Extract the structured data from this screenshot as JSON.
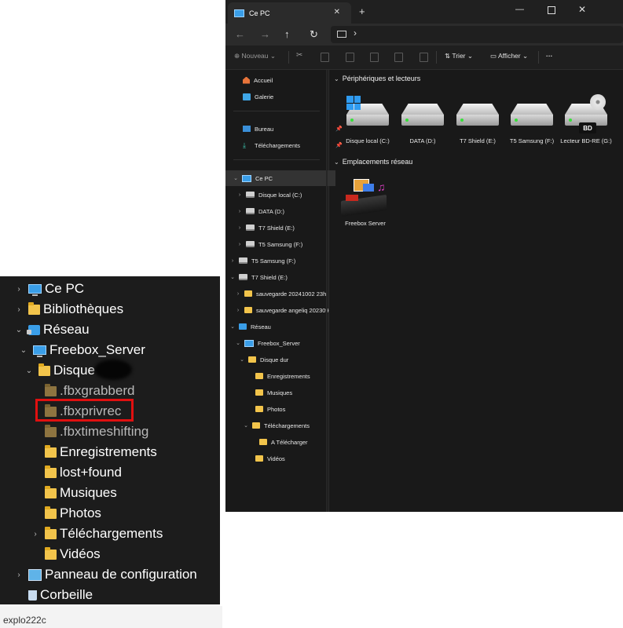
{
  "left_tree": {
    "items": [
      {
        "label": "Ce PC",
        "chev": "›",
        "icon": "pc-icon"
      },
      {
        "label": "Bibliothèques",
        "chev": "›",
        "icon": "folder-icon"
      },
      {
        "label": "Réseau",
        "chev": "⌄",
        "icon": "network-icon"
      },
      {
        "label": "Freebox_Server",
        "chev": "⌄",
        "icon": "pc-icon"
      },
      {
        "label": "Disque",
        "chev": "⌄",
        "icon": "folder-icon"
      },
      {
        "label": ".fbxgrabberd",
        "chev": "",
        "icon": "folder-icon"
      },
      {
        "label": ".fbxprivrec",
        "chev": "",
        "icon": "folder-icon"
      },
      {
        "label": ".fbxtimeshifting",
        "chev": "",
        "icon": "folder-icon"
      },
      {
        "label": "Enregistrements",
        "chev": "",
        "icon": "folder-icon"
      },
      {
        "label": "lost+found",
        "chev": "",
        "icon": "folder-icon"
      },
      {
        "label": "Musiques",
        "chev": "",
        "icon": "folder-icon"
      },
      {
        "label": "Photos",
        "chev": "",
        "icon": "folder-icon"
      },
      {
        "label": "Téléchargements",
        "chev": "›",
        "icon": "folder-icon"
      },
      {
        "label": "Vidéos",
        "chev": "",
        "icon": "folder-icon"
      },
      {
        "label": "Panneau de configuration",
        "chev": "›",
        "icon": "control-panel-icon"
      },
      {
        "label": "Corbeille",
        "chev": "",
        "icon": "recycle-bin-icon"
      }
    ],
    "highlight_color": "#e01010",
    "caption": "explo222c"
  },
  "explorer": {
    "tab_title": "Ce PC",
    "tab_close": "✕",
    "new_tab": "+",
    "window_controls": {
      "minimize": "—",
      "close": "✕"
    },
    "nav": {
      "back": "←",
      "forward": "→",
      "up": "↑",
      "refresh": "↻"
    },
    "address_chevron": "›",
    "toolbar": {
      "new_label": "Nouveau",
      "sort_label": "Trier",
      "view_label": "Afficher",
      "more": "···"
    },
    "nav_pane": {
      "quick": [
        {
          "label": "Accueil",
          "icon": "home-icon"
        },
        {
          "label": "Galerie",
          "icon": "gallery-icon"
        }
      ],
      "pinned": [
        {
          "label": "Bureau",
          "icon": "desktop-icon"
        },
        {
          "label": "Téléchargements",
          "icon": "download-icon"
        }
      ],
      "tree": [
        {
          "label": "Ce PC",
          "chev": "⌄"
        },
        {
          "label": "Disque local (C:)",
          "chev": "›"
        },
        {
          "label": "DATA (D:)",
          "chev": "›"
        },
        {
          "label": "T7 Shield (E:)",
          "chev": "›"
        },
        {
          "label": "T5 Samsung  (F:)",
          "chev": "›"
        },
        {
          "label": "T5 Samsung  (F:)",
          "chev": "›"
        },
        {
          "label": "T7 Shield (E:)",
          "chev": "⌄"
        },
        {
          "label": "sauvegarde 20241002 23h",
          "chev": "›"
        },
        {
          "label": "sauvegarde angeliq 202309",
          "chev": "›"
        },
        {
          "label": "Réseau",
          "chev": "⌄"
        },
        {
          "label": "Freebox_Server",
          "chev": "⌄"
        },
        {
          "label": "Disque dur",
          "chev": "⌄"
        },
        {
          "label": "Enregistrements",
          "chev": ""
        },
        {
          "label": "Musiques",
          "chev": ""
        },
        {
          "label": "Photos",
          "chev": ""
        },
        {
          "label": "Téléchargements",
          "chev": "⌄"
        },
        {
          "label": "A Télécharger",
          "chev": ""
        },
        {
          "label": "Vidéos",
          "chev": ""
        }
      ]
    },
    "content": {
      "section_devices": "Périphériques et lecteurs",
      "section_network": "Emplacements réseau",
      "drives": [
        {
          "label": "Disque local (C:)"
        },
        {
          "label": "DATA (D:)"
        },
        {
          "label": "T7 Shield (E:)"
        },
        {
          "label": "T5 Samsung  (F:)"
        },
        {
          "label": "Lecteur BD-RE (G:)",
          "tag": "BD"
        }
      ],
      "network_items": [
        {
          "label": "Freebox Server"
        }
      ]
    }
  }
}
